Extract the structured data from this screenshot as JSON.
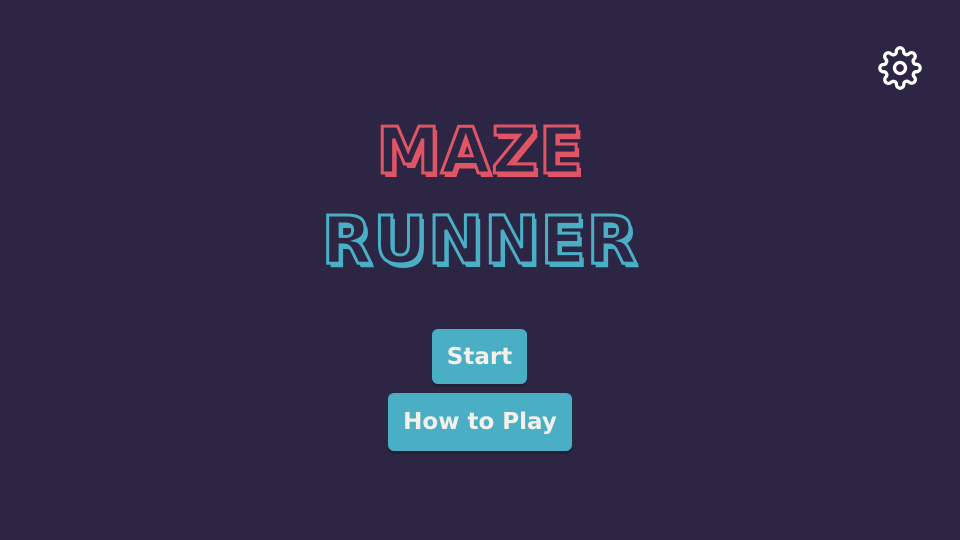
{
  "title": {
    "line1": "MAZE",
    "line2": "RUNNER"
  },
  "menu": {
    "start_label": "Start",
    "how_to_play_label": "How to Play"
  },
  "icons": {
    "settings": "gear-icon"
  },
  "colors": {
    "background": "#2c2544",
    "title_line1": "#e05566",
    "title_line2": "#4aaec5",
    "button_fill": "#4aaec5",
    "button_text": "#f4f1ea",
    "icon": "#ffffff"
  }
}
